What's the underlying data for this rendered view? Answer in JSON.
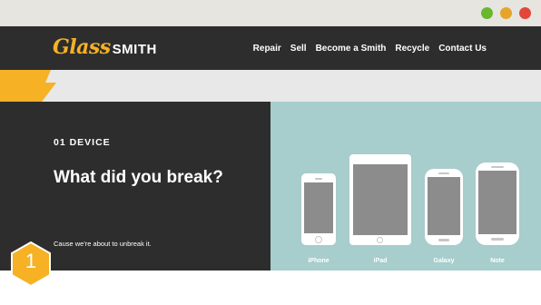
{
  "window": {
    "controls": [
      "maximize-dot",
      "minimize-dot",
      "close-dot"
    ],
    "control_colors": {
      "green": "#6ab72e",
      "yellow": "#e7a42b",
      "red": "#e2473a"
    }
  },
  "header": {
    "logo_glass": "Glass",
    "logo_smith": "SMITH",
    "nav": [
      {
        "label": "Repair"
      },
      {
        "label": "Sell"
      },
      {
        "label": "Become a Smith"
      },
      {
        "label": "Recycle"
      },
      {
        "label": "Contact Us"
      }
    ]
  },
  "step": {
    "label": "01 DEVICE",
    "headline": "What did you break?",
    "tagline": "Cause we're about to unbreak it.",
    "badge_number": "1"
  },
  "devices": [
    {
      "label": "iPhone"
    },
    {
      "label": "iPad"
    },
    {
      "label": "Galaxy"
    },
    {
      "label": "Note"
    }
  ],
  "colors": {
    "dark": "#2d2d2d",
    "accent": "#f6b125",
    "teal": "#a7cdcc",
    "stripe": "#e7e8e7"
  }
}
